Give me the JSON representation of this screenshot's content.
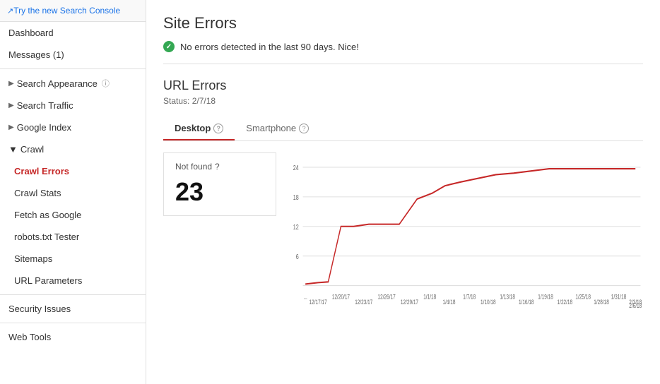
{
  "sidebar": {
    "try_new_label": "Try the new Search Console",
    "dashboard_label": "Dashboard",
    "messages_label": "Messages (1)",
    "search_appearance_label": "Search Appearance",
    "search_traffic_label": "Search Traffic",
    "google_index_label": "Google Index",
    "crawl_label": "Crawl",
    "crawl_errors_label": "Crawl Errors",
    "crawl_stats_label": "Crawl Stats",
    "fetch_as_google_label": "Fetch as Google",
    "robots_tester_label": "robots.txt Tester",
    "sitemaps_label": "Sitemaps",
    "url_parameters_label": "URL Parameters",
    "security_issues_label": "Security Issues",
    "web_tools_label": "Web Tools"
  },
  "main": {
    "page_title": "Site Errors",
    "no_errors_text": "No errors detected in the last 90 days. Nice!",
    "url_errors_title": "URL Errors",
    "status_label": "Status: 2/7/18",
    "tab_desktop": "Desktop",
    "tab_smartphone": "Smartphone",
    "not_found_label": "Not found",
    "not_found_count": "23",
    "chart": {
      "y_labels": [
        "24",
        "18",
        "12",
        "6"
      ],
      "x_labels": [
        "...",
        "12/17/17",
        "12/20/17",
        "12/23/17",
        "12/26/17",
        "12/29/17",
        "1/1/18",
        "1/4/18",
        "1/7/18",
        "1/10/18",
        "1/13/18",
        "1/16/18",
        "1/19/18",
        "1/22/18",
        "1/25/18",
        "1/28/18",
        "1/31/18",
        "2/3/18",
        "2/6/18"
      ]
    }
  }
}
